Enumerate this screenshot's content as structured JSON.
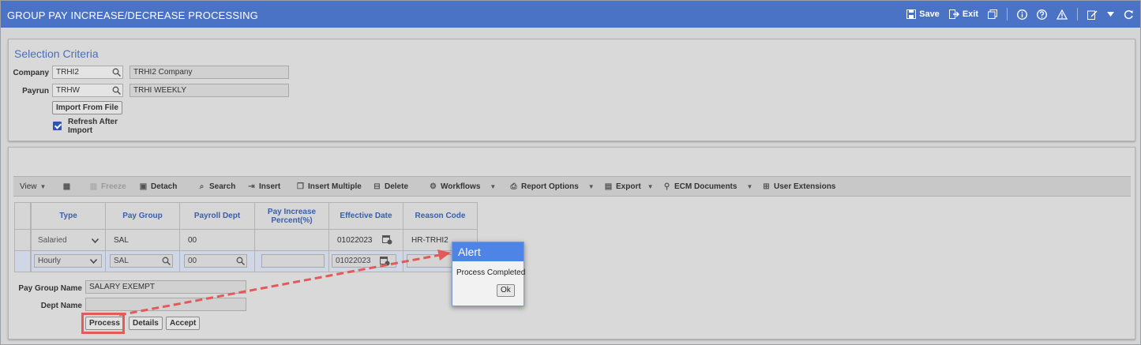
{
  "window": {
    "title": "GROUP PAY INCREASE/DECREASE PROCESSING"
  },
  "titlebar_tools": {
    "save": "Save",
    "exit": "Exit"
  },
  "selection": {
    "title": "Selection Criteria",
    "company_label": "Company",
    "company_value": "TRHI2",
    "company_desc": "TRHI2 Company",
    "payrun_label": "Payrun",
    "payrun_value": "TRHW",
    "payrun_desc": "TRHI WEEKLY",
    "import_button": "Import From File",
    "refresh_label": "Refresh After Import"
  },
  "toolbar": {
    "view": "View",
    "freeze": "Freeze",
    "detach": "Detach",
    "search": "Search",
    "insert": "Insert",
    "insert_multiple": "Insert Multiple",
    "delete": "Delete",
    "workflows": "Workflows",
    "report_options": "Report Options",
    "export": "Export",
    "ecm_documents": "ECM Documents",
    "user_extensions": "User Extensions"
  },
  "grid": {
    "columns": [
      "Type",
      "Pay Group",
      "Payroll Dept",
      "Pay Increase Percent(%)",
      "Effective Date",
      "Reason Code"
    ],
    "rows": [
      {
        "type": "Salaried",
        "pay_group": "SAL",
        "payroll_dept": "00",
        "pct": "",
        "effective_date": "01022023",
        "reason_code": "HR-TRHI2"
      },
      {
        "type": "Hourly",
        "pay_group": "SAL",
        "payroll_dept": "00",
        "pct": "",
        "effective_date": "01022023",
        "reason_code": ""
      }
    ]
  },
  "footer": {
    "pay_group_name_label": "Pay Group Name",
    "pay_group_name_value": "SALARY EXEMPT",
    "dept_name_label": "Dept Name",
    "dept_name_value": "",
    "process_button": "Process",
    "details_button": "Details",
    "accept_button": "Accept"
  },
  "alert": {
    "title": "Alert",
    "message": "Process Completed",
    "ok": "Ok"
  },
  "colors": {
    "titlebar": "#4a73c6",
    "alert_header": "#4d84e6",
    "highlight": "#e35a5a"
  }
}
